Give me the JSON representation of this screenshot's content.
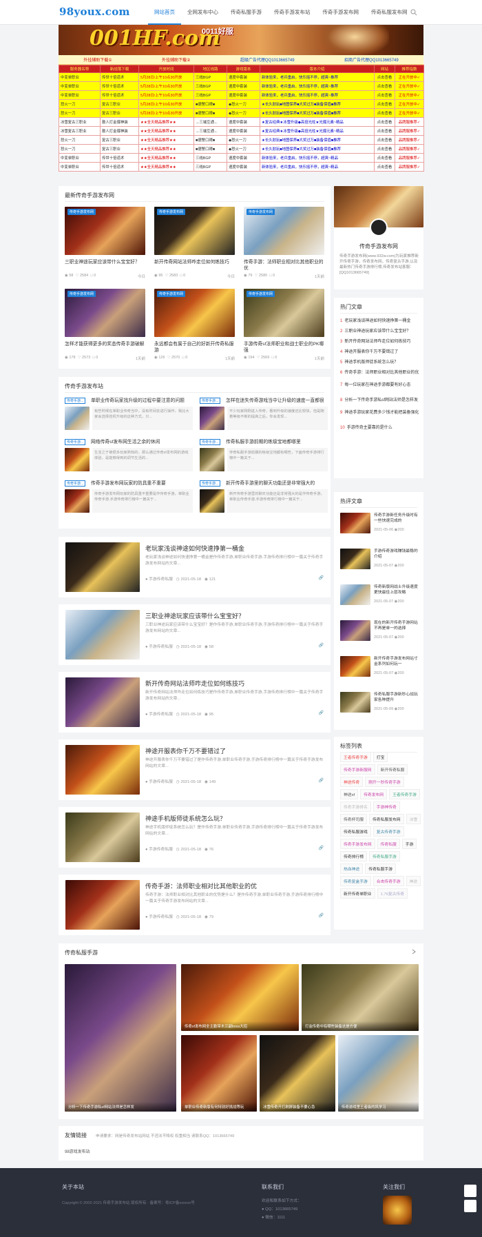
{
  "site": {
    "logo": "98youx.com"
  },
  "nav": {
    "items": [
      "网站首页",
      "全网发布中心",
      "传奇私服手游",
      "传奇手游发布站",
      "传奇手游发布网",
      "传奇私服发布网"
    ]
  },
  "banner": {
    "main": "001HF.com",
    "sub": "0011好服"
  },
  "adbar": {
    "items": [
      "外挂辅助下载①",
      "外挂辅助下载②",
      "超级广告代理QQ1013665749",
      "招商广告代理QQ1013665749"
    ]
  },
  "game_table": {
    "headers": [
      "服务器名称",
      "新战落下载",
      "开放时间",
      "地区线路",
      "游戏版本",
      "版本介绍",
      "网站",
      "推荐指数"
    ],
    "rows": [
      {
        "s": "y",
        "c": [
          "中变单职业",
          "传世十倍道术",
          "5月28日/上午10点30开放",
          "三线BGP",
          "速度中套装",
          "新体验来，老兵重启，快乐摇不停，超爽~推荐",
          "点击查看",
          "正在开放中✓"
        ]
      },
      {
        "s": "y",
        "c": [
          "中变单职业",
          "传世十倍道术",
          "5月28日/上午10点30开放",
          "三线BGP",
          "速度中套装",
          "新体验来，老兵重启，快乐摇不停，超爽~推荐",
          "点击查看",
          "正在开放中✓"
        ]
      },
      {
        "s": "y",
        "c": [
          "中变单职业",
          "传世十倍道术",
          "5月28日/上午10点30开放",
          "三线BGP",
          "速度中套装",
          "新体验来，老兵重启，快乐摇不停，超爽~推荐",
          "点击查看",
          "正在开放中✓"
        ]
      },
      {
        "s": "y",
        "c": [
          "怒火一刀",
          "复古三职业",
          "5月28日/上午10点30开放",
          "■德警口碑■",
          "◆怒火一刀",
          "★长久耐玩■地图保养■大奖过万■装备保值■推荐",
          "点击查看",
          "正在开放中✓"
        ]
      },
      {
        "s": "y",
        "c": [
          "怒火一刀",
          "复古三职业",
          "5月28日/上午10点30开放",
          "■德警口碑■",
          "◆怒火一刀",
          "★长久耐玩■地图保养■大奖过万■装备保值■推荐",
          "点击查看",
          "正在开放中✓"
        ]
      },
      {
        "s": "w",
        "c": [
          "冰雪复古三职业",
          "散人打金爆神装",
          "★★全天精品推荐★★",
          "→三端互通←",
          "速度中套装",
          "★复古经典★冰雪升级◆高倍光柱★光爆元素~精品",
          "点击查看",
          "品牌服推荐✓"
        ]
      },
      {
        "s": "w",
        "c": [
          "冰雪复古三职业",
          "散人打金爆神装",
          "★★全天精品推荐★★",
          "→三端互通←",
          "速度中套装",
          "★复古经典★冰雪升级◆高倍光柱★光爆元素~精品",
          "点击查看",
          "品牌服推荐✓"
        ]
      },
      {
        "s": "w",
        "c": [
          "怒火一刀",
          "复古三职业",
          "★★全天精品推荐★★",
          "■德警口碑■",
          "◆怒火一刀",
          "★长久耐玩■地图保养■大奖过万■装备保值■推荐",
          "点击查看",
          "品牌服推荐✓"
        ]
      },
      {
        "s": "w",
        "c": [
          "怒火一刀",
          "复古三职业",
          "★★全天精品推荐★★",
          "■德警口碑■",
          "◆怒火一刀",
          "★长久耐玩■地图保养■大奖过万■装备保值■推荐",
          "点击查看",
          "品牌服推荐✓"
        ]
      },
      {
        "s": "w",
        "c": [
          "中变单职业",
          "传世十倍道术",
          "★★全天精品推荐★★",
          "三线BGP",
          "速度中套装",
          "新体验来，老兵重启，快乐摇不停，超爽~精品",
          "点击查看",
          "品牌服推荐✓"
        ]
      },
      {
        "s": "w",
        "c": [
          "中变单职业",
          "传世十倍道术",
          "★★全天精品推荐★★",
          "三线BGP",
          "速度中套装",
          "新体验来，老兵重启，快乐摇不停，超爽~精品",
          "点击查看",
          "品牌服推荐✓"
        ]
      }
    ]
  },
  "latest": {
    "title": "最新传奇手游发布网",
    "badge": "传奇手游发布网",
    "items": [
      {
        "title": "三职业神途玩家应该带什么宝宝好？",
        "views": "58",
        "likes": "2584",
        "comments": "0",
        "date": "今日"
      },
      {
        "title": "新开传奇网站法师咋走位如何练技巧",
        "views": "95",
        "likes": "2583",
        "comments": "0",
        "date": "今日"
      },
      {
        "title": "传奇手游：法师职业相对比其他职业的优",
        "views": "79",
        "likes": "2580",
        "comments": "0",
        "date": "1天前"
      },
      {
        "title": "怎样才能获得更多的奖态传奇手游破解",
        "views": "178",
        "likes": "2573",
        "comments": "0",
        "date": "1天前"
      },
      {
        "title": "永远都会有属于自己的好新开传奇私服游",
        "views": "126",
        "likes": "2570",
        "comments": "0",
        "date": "1天前"
      },
      {
        "title": "手游传奇sf法师职业和战士职业的PK哪强",
        "views": "194",
        "likes": "2569",
        "comments": "0",
        "date": "1天前"
      }
    ]
  },
  "station": {
    "title": "传奇手游发布站",
    "badge": "传奇手游...",
    "items": [
      {
        "title": "单职业传奇玩家找升级的过程中要注意的问题",
        "desc": "有些时候在单职业传奇当中，没有时间去进行操作，我比大家会选择挂机升级的这种方式，只..."
      },
      {
        "title": "怎样在迷失传奇游戏当中让升级的速度一直都很",
        "desc": "不少玩家刚刚进入传奇，看到升级的速度还比较快，但是随着等级不断的提高之后，你会发现..."
      },
      {
        "title": "网络传奇sf发布网生活之余的休闲",
        "desc": "生活之于被很多玩家熟知的，那么通过传奇sf发布网的游戏体验，是能够得到的调节生活的..."
      },
      {
        "title": "传奇私服手游前期的练级宝地都哪里",
        "desc": "传奇私服手游前期的练级宝地都有哪些，下面传奇手游排行榜中一篇关于..."
      },
      {
        "title": "传奇手游发布网玩家的防具重不重要",
        "desc": "传奇手游发布网玩家的防具重不重要是作传奇手游，单职业传奇手游,手游传奇排行榜中一篇关于..."
      },
      {
        "title": "新开传奇手游里的聊天功能还是非常强大的",
        "desc": "新开传奇手游里的聊天功能还是非常强大的是作传奇手游，单职业传奇手游,手游传奇排行榜中一篇关于..."
      }
    ]
  },
  "features": [
    {
      "title": "老玩家浅谈神途如何快速挣第一桶金",
      "desc": "老玩家浅谈神途如何快速挣第一桶金是作传奇手游,单职业传奇手游,手游传奇排行榜中一篇关于传奇手游发布网站的文章...",
      "author": "手游传奇私服",
      "date": "2021-05-18",
      "views": "121"
    },
    {
      "title": "三职业神途玩家应该带什么宝宝好？",
      "desc": "三职业神途玩家应该带什么宝宝好？是作传奇手游,单职业传奇手游,手游传奇排行榜中一篇关于传奇手游发布网站的文章...",
      "author": "手游传奇私服",
      "date": "2021-05-18",
      "views": "58"
    },
    {
      "title": "新开传奇网站法师咋走位如何练技巧",
      "desc": "新开传奇网站法师咋走位如何练技巧是作传奇手游,单职业传奇手游,手游传奇排行榜中一篇关于传奇手游发布网站的文章...",
      "author": "手游传奇私服",
      "date": "2021-05-18",
      "views": "95"
    },
    {
      "title": "神途开服表你千万不要错过了",
      "desc": "神途开服表你千万不要错过了是作传奇手游,单职业传奇手游,手游传奇排行榜中一篇关于传奇手游发布网站的文章...",
      "author": "手游传奇私服",
      "date": "2021-05-18",
      "views": "149"
    },
    {
      "title": "神途手机版师徒系统怎么玩？",
      "desc": "神途手机版师徒系统怎么玩？是作传奇手游,单职业传奇手游,手游传奇排行榜中一篇关于传奇手游发布网站的文章...",
      "author": "手游传奇私服",
      "date": "2021-05-18",
      "views": "76"
    },
    {
      "title": "传奇手游：法师职业相对比其他职业的优",
      "desc": "传奇手游：法师职业相对比其他职业的优势是什么？是作传奇手游,单职业传奇手游,手游传奇排行榜中一篇关于传奇手游发布网站的文章...",
      "author": "手游传奇私服",
      "date": "2021-05-18",
      "views": "79"
    }
  ],
  "profile": {
    "name": "传奇手游发布网",
    "desc": "传奇手游发布网(www.932w.com)为玩家推荐新开传奇手游，传奇发布网，传奇复古手游,以及最新热门传奇手游排行榜,传奇发布站客服：[QQ1013665749]"
  },
  "hot": {
    "title": "热门文章",
    "items": [
      "老玩家浅谈神途如何快速挣第一桶金",
      "三职业神途玩家应该带什么宝宝好？",
      "新开传奇网站法师咋走位如何练技巧",
      "神途开服表你千万不要错过了",
      "神途手机版师徒系统怎么玩？",
      "传奇手游：法师职业相对比其他职业的优",
      "每一位玩家在神途手游都要有好心态",
      "分析一下传奇手游私sf网站法师是怎样发",
      "神途手游玩家花费多少钱才能把装备强化",
      "手游传奇主要靠的是什么"
    ]
  },
  "hotcomment": {
    "title": "热评文章",
    "items": [
      {
        "title": "传奇手游新任务升级时有一些快速完成的",
        "date": "2021-05-06",
        "views": "200"
      },
      {
        "title": "手游传奇游戏赚钱最稳的介绍",
        "date": "2021-05-07",
        "views": "200"
      },
      {
        "title": "传奇新版网战士升级速度更快最佳上层攻略",
        "date": "2021-05-07",
        "views": "200"
      },
      {
        "title": "现在的新开传奇手游网站不再是单一的选择",
        "date": "2021-05-07",
        "views": "200"
      },
      {
        "title": "新开传奇手游发布网站寸金系列如何玩一",
        "date": "2021-05-07",
        "views": "200"
      },
      {
        "title": "传奇私服手游新秒心战玩家各种提升",
        "date": "2021-05-09",
        "views": "200"
      }
    ]
  },
  "tags": {
    "title": "标签列表",
    "items": [
      "王者传奇手游",
      "打宝",
      "传奇手游新服网",
      "新开传奇私服",
      "神途传奇",
      "刚开一秒传奇手游",
      "神途sf",
      "传奇发布网",
      "王者传奇手游",
      "传奇手游排名",
      "手游神传奇",
      "传奇杯司服",
      "传奇私服发布网",
      "冰雪",
      "传奇私服游戏",
      "复古传奇手游",
      "传奇手游发布网",
      "传奇私服",
      "手游",
      "传奇排行榜",
      "传奇私服手游",
      "热血神途",
      "传奇私服手游",
      "传奇复盒手游",
      "合击传奇手游",
      "神途",
      "新开传奇单职业",
      "1.76复古传奇"
    ]
  },
  "gallery": {
    "title": "传奇私服手游",
    "items": [
      "分析一下传奇手游私sf网站法师是怎样发",
      "传奇sf发布网全主勤带木兰副boss大招",
      "打金传奇中有哪些装备这是方便",
      "单职业传奇新版有何特别好挑战等玩",
      "冰雪传奇开打刷屏装备不要心急",
      "传奇游戏里王者级的风学习"
    ]
  },
  "links": {
    "title": "友情链接",
    "note": "申请要求：网是传奇发布站网站 不违法不降权 权重相当 请联系QQ：1013665749",
    "items": [
      "98游戏发布站"
    ]
  },
  "footer": {
    "about_title": "关于本站",
    "copyright": "Copyright © 2002-2021 传奇手游发布站 版权所有 · 备案号：粤ICP备xxxxxx号",
    "contact_title": "联系我们",
    "contact_intro": "欢迎和联系如下方式：",
    "qq": "QQ：1013665749",
    "wechat": "微信：1111",
    "follow_title": "关注我们"
  }
}
